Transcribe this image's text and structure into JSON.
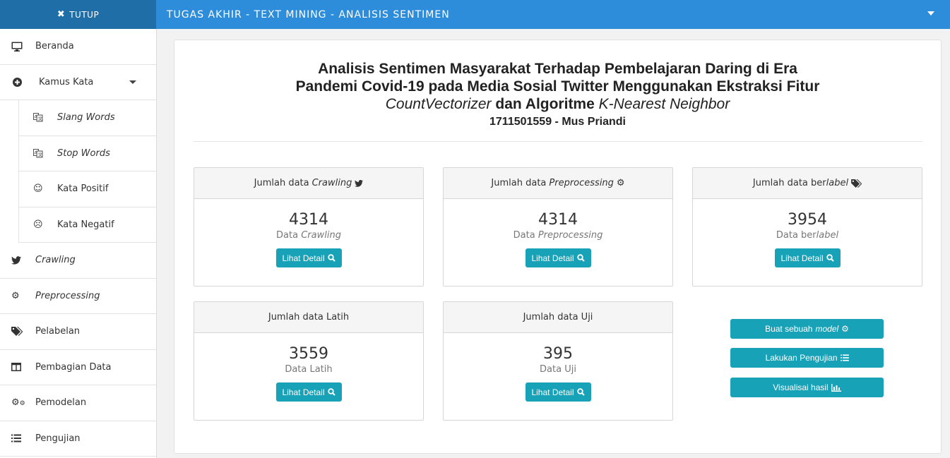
{
  "topbar": {
    "close_label": "TUTUP",
    "app_title": "TUGAS AKHIR - TEXT MINING - ANALISIS SENTIMEN"
  },
  "sidebar": {
    "items": [
      {
        "label": "Beranda",
        "icon": "monitor-icon"
      },
      {
        "label": "Kamus Kata",
        "icon": "plus-circle-icon"
      },
      {
        "label": "Slang Words",
        "icon": "translate-icon"
      },
      {
        "label": "Stop Words",
        "icon": "translate-icon"
      },
      {
        "label": "Kata Positif",
        "icon": "smile-icon"
      },
      {
        "label": "Kata Negatif",
        "icon": "frown-icon"
      },
      {
        "label": "Crawling",
        "icon": "twitter-icon"
      },
      {
        "label": "Preprocessing",
        "icon": "gear-icon"
      },
      {
        "label": "Pelabelan",
        "icon": "tags-icon"
      },
      {
        "label": "Pembagian Data",
        "icon": "columns-icon"
      },
      {
        "label": "Pemodelan",
        "icon": "gears-icon"
      },
      {
        "label": "Pengujian",
        "icon": "list-icon"
      }
    ]
  },
  "main": {
    "title_line1": "Analisis Sentimen Masyarakat Terhadap Pembelajaran Daring di Era",
    "title_line2": "Pandemi Covid-19 pada Media Sosial Twitter Menggunakan Ekstraksi Fitur",
    "title_line3_a": "CountVectorizer",
    "title_line3_b": "dan Algoritme",
    "title_line3_c": "K-Nearest Neighbor",
    "author": "1711501559 - Mus Priandi",
    "cards": [
      {
        "head_prefix": "Jumlah data",
        "head_em": "Crawling",
        "head_suffix": "",
        "count": "4314",
        "sub_prefix": "Data",
        "sub_em": "Crawling",
        "button": "Lihat Detail",
        "icon": "twitter-icon"
      },
      {
        "head_prefix": "Jumlah data",
        "head_em": "Preprocessing",
        "head_suffix": "",
        "count": "4314",
        "sub_prefix": "Data",
        "sub_em": "Preprocessing",
        "button": "Lihat Detail",
        "icon": "gear-icon"
      },
      {
        "head_prefix": "Jumlah data ber",
        "head_em": "label",
        "head_suffix": "",
        "count": "3954",
        "sub_prefix": "Data ber",
        "sub_em": "label",
        "button": "Lihat Detail",
        "icon": "tags-icon"
      },
      {
        "head_prefix": "Jumlah data Latih",
        "head_em": "",
        "head_suffix": "",
        "count": "3559",
        "sub_prefix": "Data Latih",
        "sub_em": "",
        "button": "Lihat Detail",
        "icon": ""
      },
      {
        "head_prefix": "Jumlah data Uji",
        "head_em": "",
        "head_suffix": "",
        "count": "395",
        "sub_prefix": "Data Uji",
        "sub_em": "",
        "button": "Lihat Detail",
        "icon": ""
      }
    ],
    "actions": {
      "model_prefix": "Buat sebuah",
      "model_em": "model",
      "test": "Lakukan Pengujian",
      "visual": "Visualisai hasil"
    }
  },
  "colors": {
    "topbar": "#2e8ddb",
    "close_bg": "#1f6ea8",
    "button": "#17a2b8"
  }
}
